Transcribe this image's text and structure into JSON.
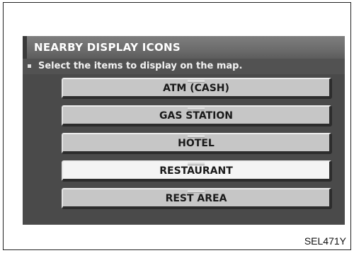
{
  "screen": {
    "title": "NEARBY DISPLAY ICONS",
    "instruction": "Select the items to display on the map."
  },
  "buttons": [
    {
      "label": "ATM (CASH)",
      "highlighted": false
    },
    {
      "label": "GAS STATION",
      "highlighted": false
    },
    {
      "label": "HOTEL",
      "highlighted": false
    },
    {
      "label": "RESTAURANT",
      "highlighted": true
    },
    {
      "label": "REST AREA",
      "highlighted": false
    }
  ],
  "figure_code": "SEL471Y",
  "colors": {
    "screen_background": "#4a4a4a",
    "button_face": "#c6c6c6",
    "button_highlight": "#f4f4f4",
    "text_light": "#ffffff"
  }
}
